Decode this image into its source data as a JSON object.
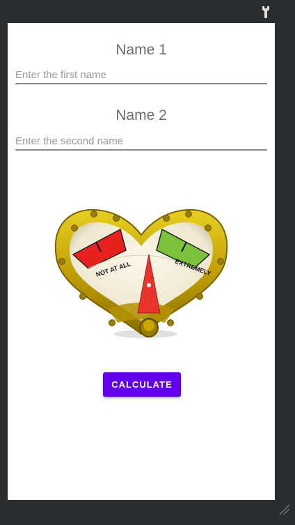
{
  "form": {
    "name1_label": "Name 1",
    "name1_placeholder": "Enter the first name",
    "name1_value": "",
    "name2_label": "Name 2",
    "name2_placeholder": "Enter the second name",
    "name2_value": ""
  },
  "meter": {
    "low_label": "NOT AT ALL",
    "high_label": "EXTREMELY",
    "low_color": "#e8201e",
    "high_color": "#7cc23a",
    "needle_color": "#e8342c",
    "frame_color": "#c9a800"
  },
  "actions": {
    "calculate_label": "CALCULATE",
    "accent": "#6200ee"
  },
  "icons": {
    "status": "wrench-icon",
    "corner": "resize-handle-icon"
  }
}
